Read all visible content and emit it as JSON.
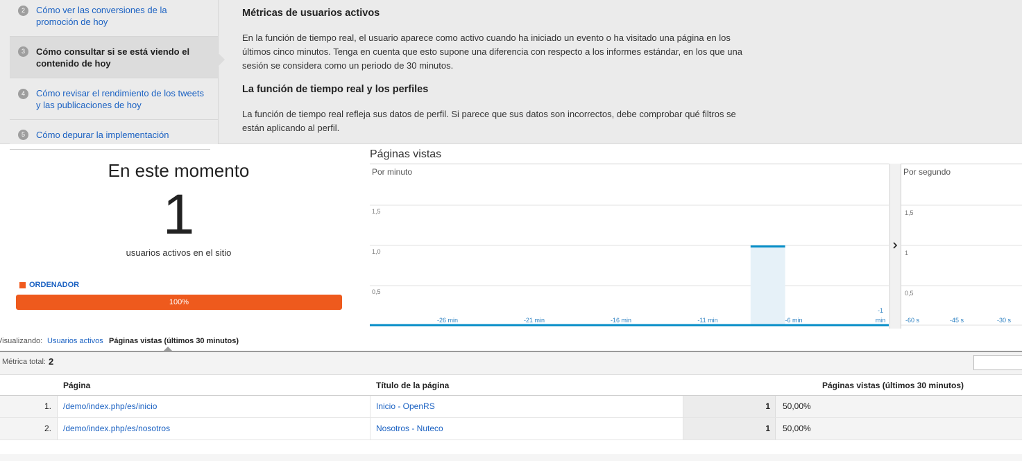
{
  "help": {
    "steps": [
      {
        "num": "2",
        "label": "Cómo ver las conversiones de la promoción de hoy",
        "active": false
      },
      {
        "num": "3",
        "label": "Cómo consultar si se está viendo el contenido de hoy",
        "active": true
      },
      {
        "num": "4",
        "label": "Cómo revisar el rendimiento de los tweets y las publicaciones de hoy",
        "active": false
      },
      {
        "num": "5",
        "label": "Cómo depurar la implementación",
        "active": false
      }
    ],
    "article": {
      "heading1": "Métricas de usuarios activos",
      "para1": "En la función de tiempo real, el usuario aparece como activo cuando ha iniciado un evento o ha visitado una página en los últimos cinco minutos. Tenga en cuenta que esto supone una diferencia con respecto a los informes estándar, en los que una sesión se considera como un periodo de 30 minutos.",
      "heading2": "La función de tiempo real y los perfiles",
      "para2": "La función de tiempo real refleja sus datos de perfil. Si parece que sus datos son incorrectos, debe comprobar qué filtros se están aplicando al perfil."
    }
  },
  "now": {
    "title": "En este momento",
    "count": "1",
    "subtitle": "usuarios activos en el sitio",
    "device_label": "ORDENADOR",
    "device_pct": "100%",
    "device_fraction": 1.0,
    "device_color": "#ee5a1d"
  },
  "pageviews": {
    "title": "Páginas vistas"
  },
  "chart_data": [
    {
      "type": "bar",
      "title": "Por minuto",
      "yticks": [
        "1,5",
        "1,0",
        "0,5"
      ],
      "ylim": [
        0,
        2
      ],
      "xticks": [
        "-26 min",
        "-21 min",
        "-16 min",
        "-11 min",
        "-6 min",
        "-1 min"
      ],
      "x": [
        -30,
        -29,
        -28,
        -27,
        -26,
        -25,
        -24,
        -23,
        -22,
        -21,
        -20,
        -19,
        -18,
        -17,
        -16,
        -15,
        -14,
        -13,
        -12,
        -11,
        -10,
        -9,
        -8,
        -7,
        -6,
        -5,
        -4,
        -3,
        -2,
        -1
      ],
      "values": [
        0,
        0,
        0,
        0,
        0,
        0,
        0,
        0,
        0,
        0,
        0,
        0,
        0,
        0,
        0,
        0,
        0,
        0,
        0,
        0,
        0,
        0,
        0,
        0,
        0,
        0,
        1,
        0,
        0,
        0
      ],
      "color": "#058dc7",
      "highlight_color": "#e6f1f8"
    },
    {
      "type": "bar",
      "title": "Por segundo",
      "yticks": [
        "1,5",
        "1",
        "0,5"
      ],
      "ylim": [
        0,
        2
      ],
      "xticks": [
        "-60 s",
        "-45 s",
        "-30 s"
      ],
      "values": [],
      "color": "#058dc7"
    }
  ],
  "view": {
    "label": "Visualizando:",
    "option1": "Usuarios activos",
    "option2": "Páginas vistas (últimos 30 minutos)"
  },
  "metric": {
    "label": "Métrica total:",
    "value": "2"
  },
  "table": {
    "headers": {
      "page": "Página",
      "title": "Título de la página",
      "views": "Páginas vistas (últimos 30 minutos)"
    },
    "rows": [
      {
        "idx": "1.",
        "page": "/demo/index.php/es/inicio",
        "title": "Inicio - OpenRS",
        "views": "1",
        "pct": "50,00%"
      },
      {
        "idx": "2.",
        "page": "/demo/index.php/es/nosotros",
        "title": "Nosotros - Nuteco",
        "views": "1",
        "pct": "50,00%"
      }
    ]
  }
}
